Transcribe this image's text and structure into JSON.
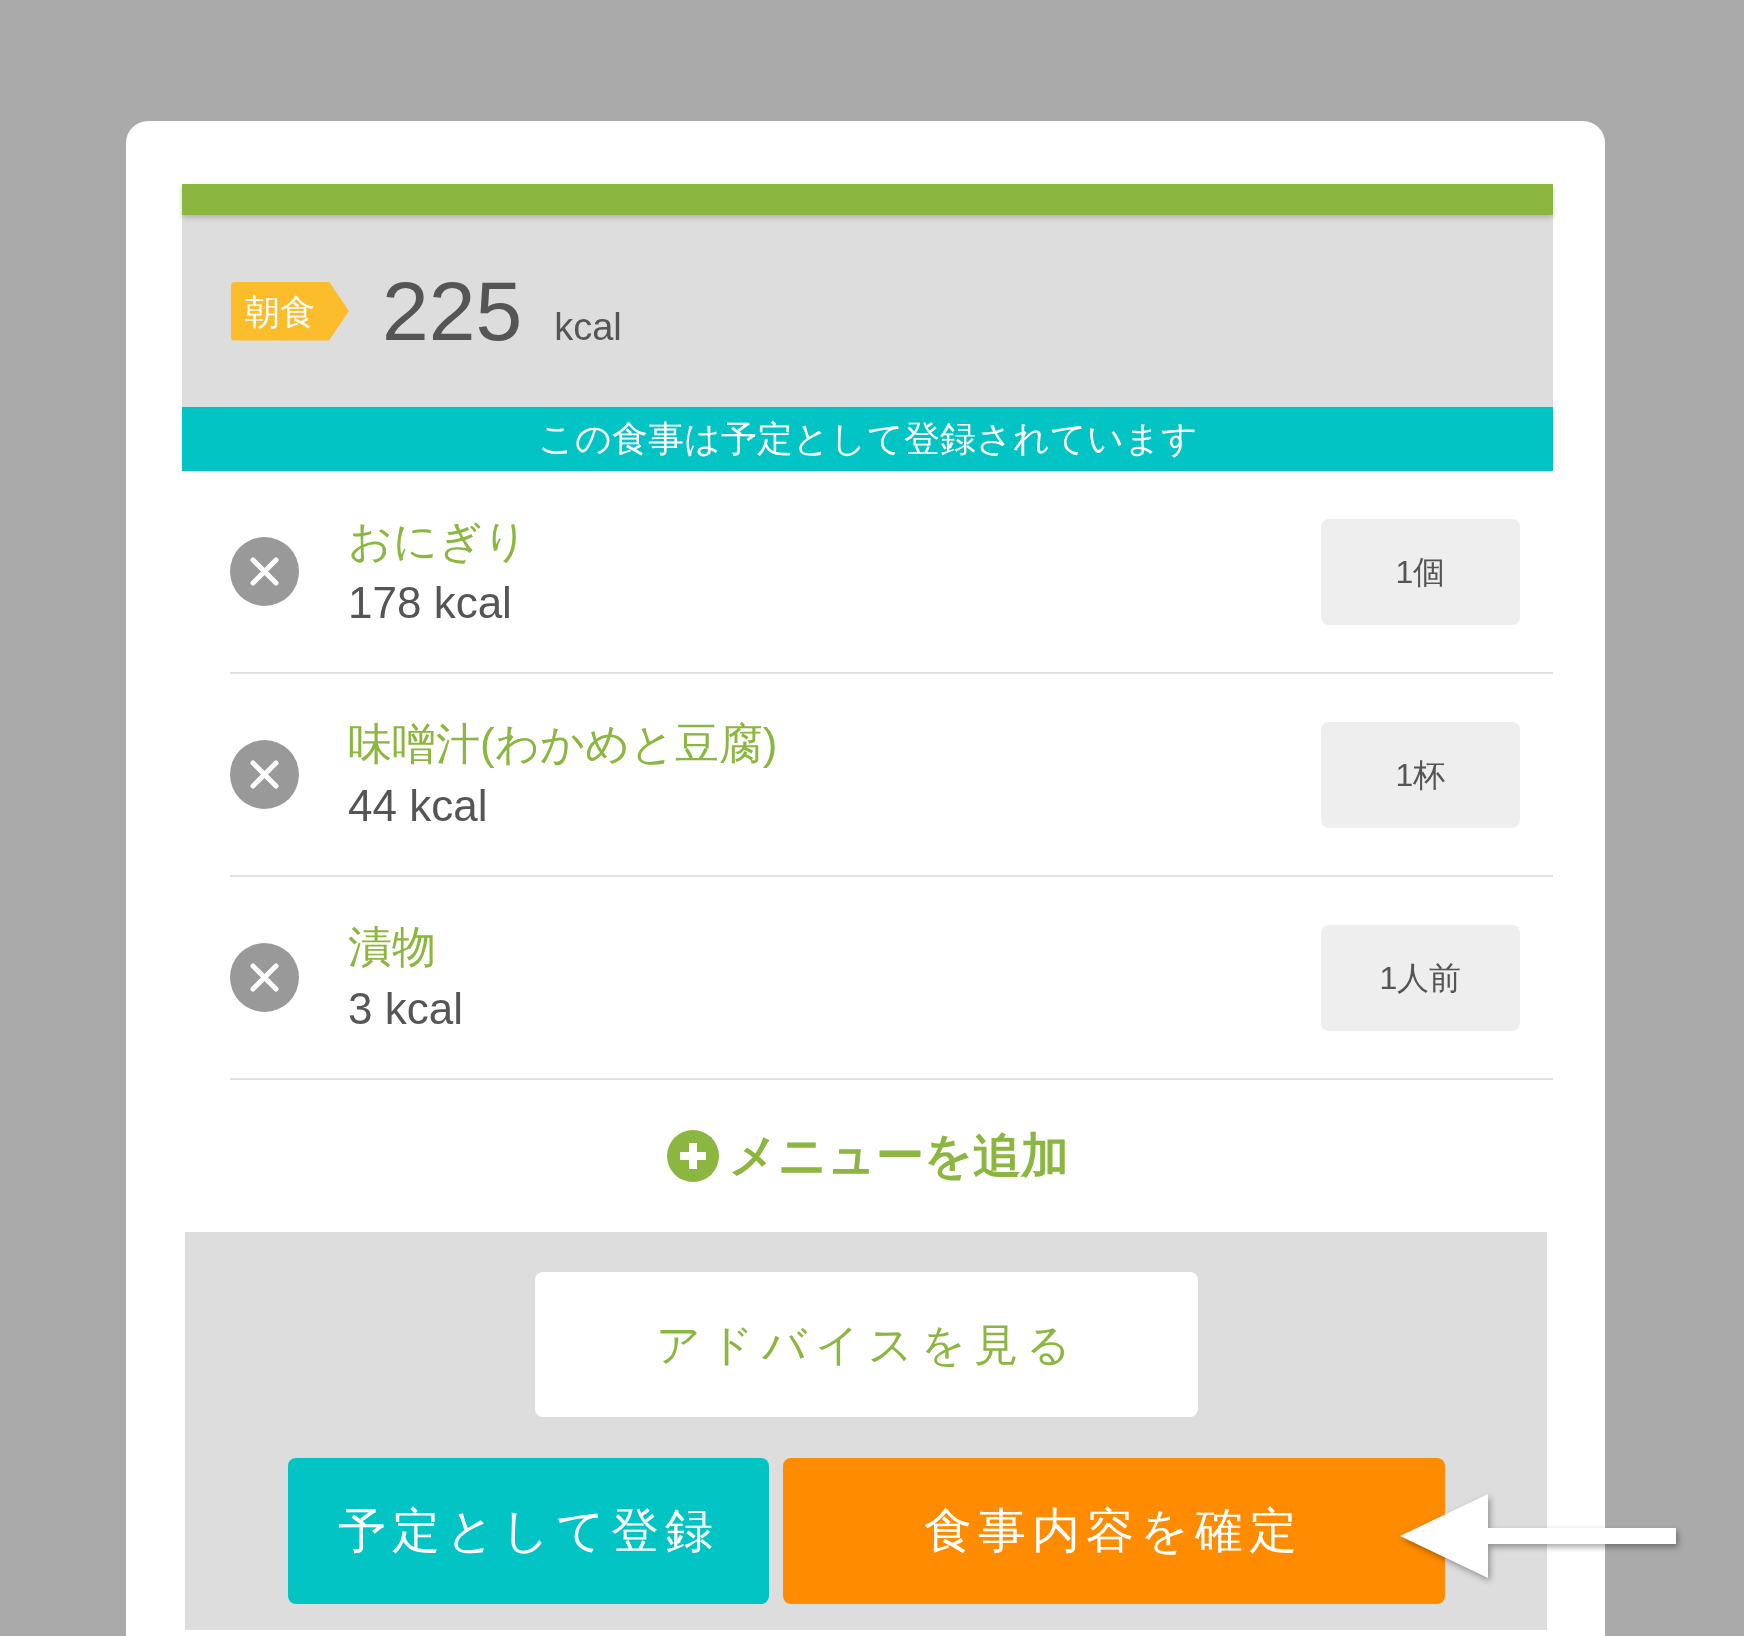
{
  "header": {
    "meal_tag": "朝食",
    "total_calories": "225",
    "unit": "kcal"
  },
  "banner": {
    "text": "この食事は予定として登録されています"
  },
  "items": [
    {
      "name": "おにぎり",
      "calories": "178 kcal",
      "quantity": "1個"
    },
    {
      "name": "味噌汁(わかめと豆腐)",
      "calories": "44 kcal",
      "quantity": "1杯"
    },
    {
      "name": "漬物",
      "calories": "3 kcal",
      "quantity": "1人前"
    }
  ],
  "add_menu": {
    "label": "メニューを追加"
  },
  "advice_button": {
    "label": "アドバイスを見る"
  },
  "actions": [
    {
      "kind": "plan",
      "label": "予定として登録"
    },
    {
      "kind": "confirm",
      "label": "食事内容を確定"
    }
  ],
  "annotation": {
    "kind": "arrow"
  }
}
